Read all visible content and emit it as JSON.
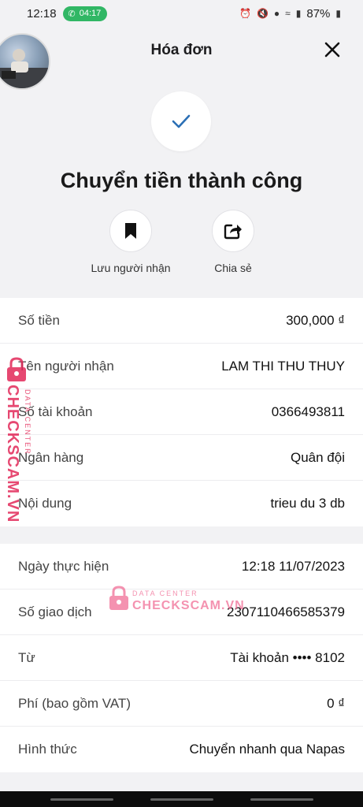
{
  "status_bar": {
    "time": "12:18",
    "call_timer": "04:17",
    "battery": "87%"
  },
  "header": {
    "title": "Hóa đơn",
    "close_icon": "close-icon"
  },
  "success": {
    "title": "Chuyển tiền thành công",
    "icon": "check-icon",
    "accent_color": "#2b6fb5"
  },
  "actions": [
    {
      "label": "Lưu người nhận",
      "icon": "bookmark-icon"
    },
    {
      "label": "Chia sẻ",
      "icon": "share-icon"
    }
  ],
  "details": [
    {
      "label": "Số tiền",
      "value": "300,000 ₫"
    },
    {
      "label": "Tên người nhận",
      "value": "LAM THI THU THUY"
    },
    {
      "label": "Số tài khoản",
      "value": "0366493811"
    },
    {
      "label": "Ngân hàng",
      "value": "Quân đội"
    },
    {
      "label": "Nội dung",
      "value": "trieu du 3 db"
    }
  ],
  "transaction": [
    {
      "label": "Ngày thực hiện",
      "value": "12:18 11/07/2023"
    },
    {
      "label": "Số giao dịch",
      "value": "2307110466585379"
    },
    {
      "label": "Từ",
      "value": "Tài khoản •••• 8102"
    },
    {
      "label": "Phí (bao gồm VAT)",
      "value": "0 ₫"
    },
    {
      "label": "Hình thức",
      "value": "Chuyển nhanh qua Napas"
    }
  ],
  "watermark": {
    "brand": "CHECKSCAM.VN",
    "tagline": "DATA CENTER",
    "color": "#e22858"
  }
}
